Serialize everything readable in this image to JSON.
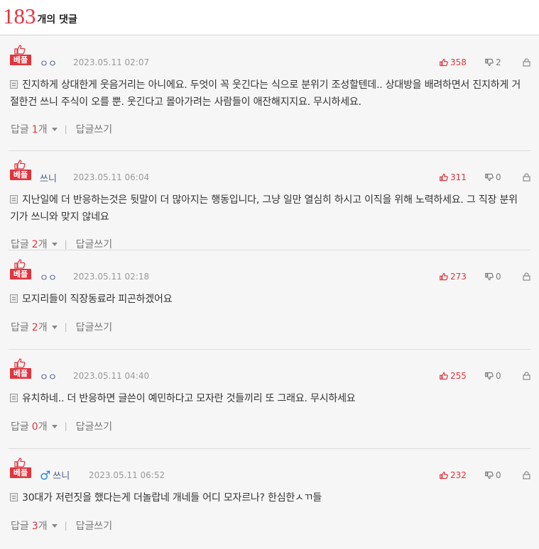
{
  "header": {
    "count": "183",
    "count_label": "개의 댓글"
  },
  "labels": {
    "best": "베플",
    "reply": "답글",
    "reply_unit": "개",
    "write_reply": "답글쓰기"
  },
  "comments": [
    {
      "nickname": "ㅇㅇ",
      "gender": "",
      "date": "2023.05.11 02:07",
      "likes": "358",
      "dislikes": "2",
      "content": "진지하게 상대한게 웃음거리는 아니에요. 두엇이 꼭 웃긴다는 식으로 분위기 조성할텐데.. 상대방을 배려하면서 진지하게 거절한건 쓰니 주식이 오를 뿐. 웃긴다고 몰아가려는 사람들이 애잔해지지요. 무시하세요.",
      "reply_count": "1"
    },
    {
      "nickname": "쓰니",
      "gender": "",
      "date": "2023.05.11 06:04",
      "likes": "311",
      "dislikes": "0",
      "content": "지난일에 더 반응하는것은 뒷말이 더 많아지는 행동입니다, 그냥 일만 열심히 하시고 이직을 위해 노력하세요. 그 직장 분위기가 쓰니와 맞지 않네요",
      "reply_count": "2"
    },
    {
      "nickname": "ㅇㅇ",
      "gender": "",
      "date": "2023.05.11 02:18",
      "likes": "273",
      "dislikes": "0",
      "content": "모지리들이 직장동료라 피곤하겠어요",
      "reply_count": "2"
    },
    {
      "nickname": "ㅇㅇ",
      "gender": "",
      "date": "2023.05.11 04:40",
      "likes": "255",
      "dislikes": "0",
      "content": "유치하네.. 더 반응하면 글쓴이 예민하다고 모자란 것들끼리 또 그래요. 무시하세요",
      "reply_count": "0"
    },
    {
      "nickname": "쓰니",
      "gender": "♂",
      "date": "2023.05.11 06:52",
      "likes": "232",
      "dislikes": "0",
      "content": "30대가 저런짓을 했다는게 더놀랍네 개네들 어디 모자르나? 한심한ㅅㄲ들",
      "reply_count": "3"
    }
  ],
  "icons": [
    "thumbs-up-icon",
    "thumbs-down-icon",
    "lock-icon",
    "document-icon",
    "caret-down-icon",
    "male-icon"
  ],
  "colors": {
    "accent": "#e2343e",
    "nickname": "#4c5a86",
    "male": "#2a86d6"
  }
}
